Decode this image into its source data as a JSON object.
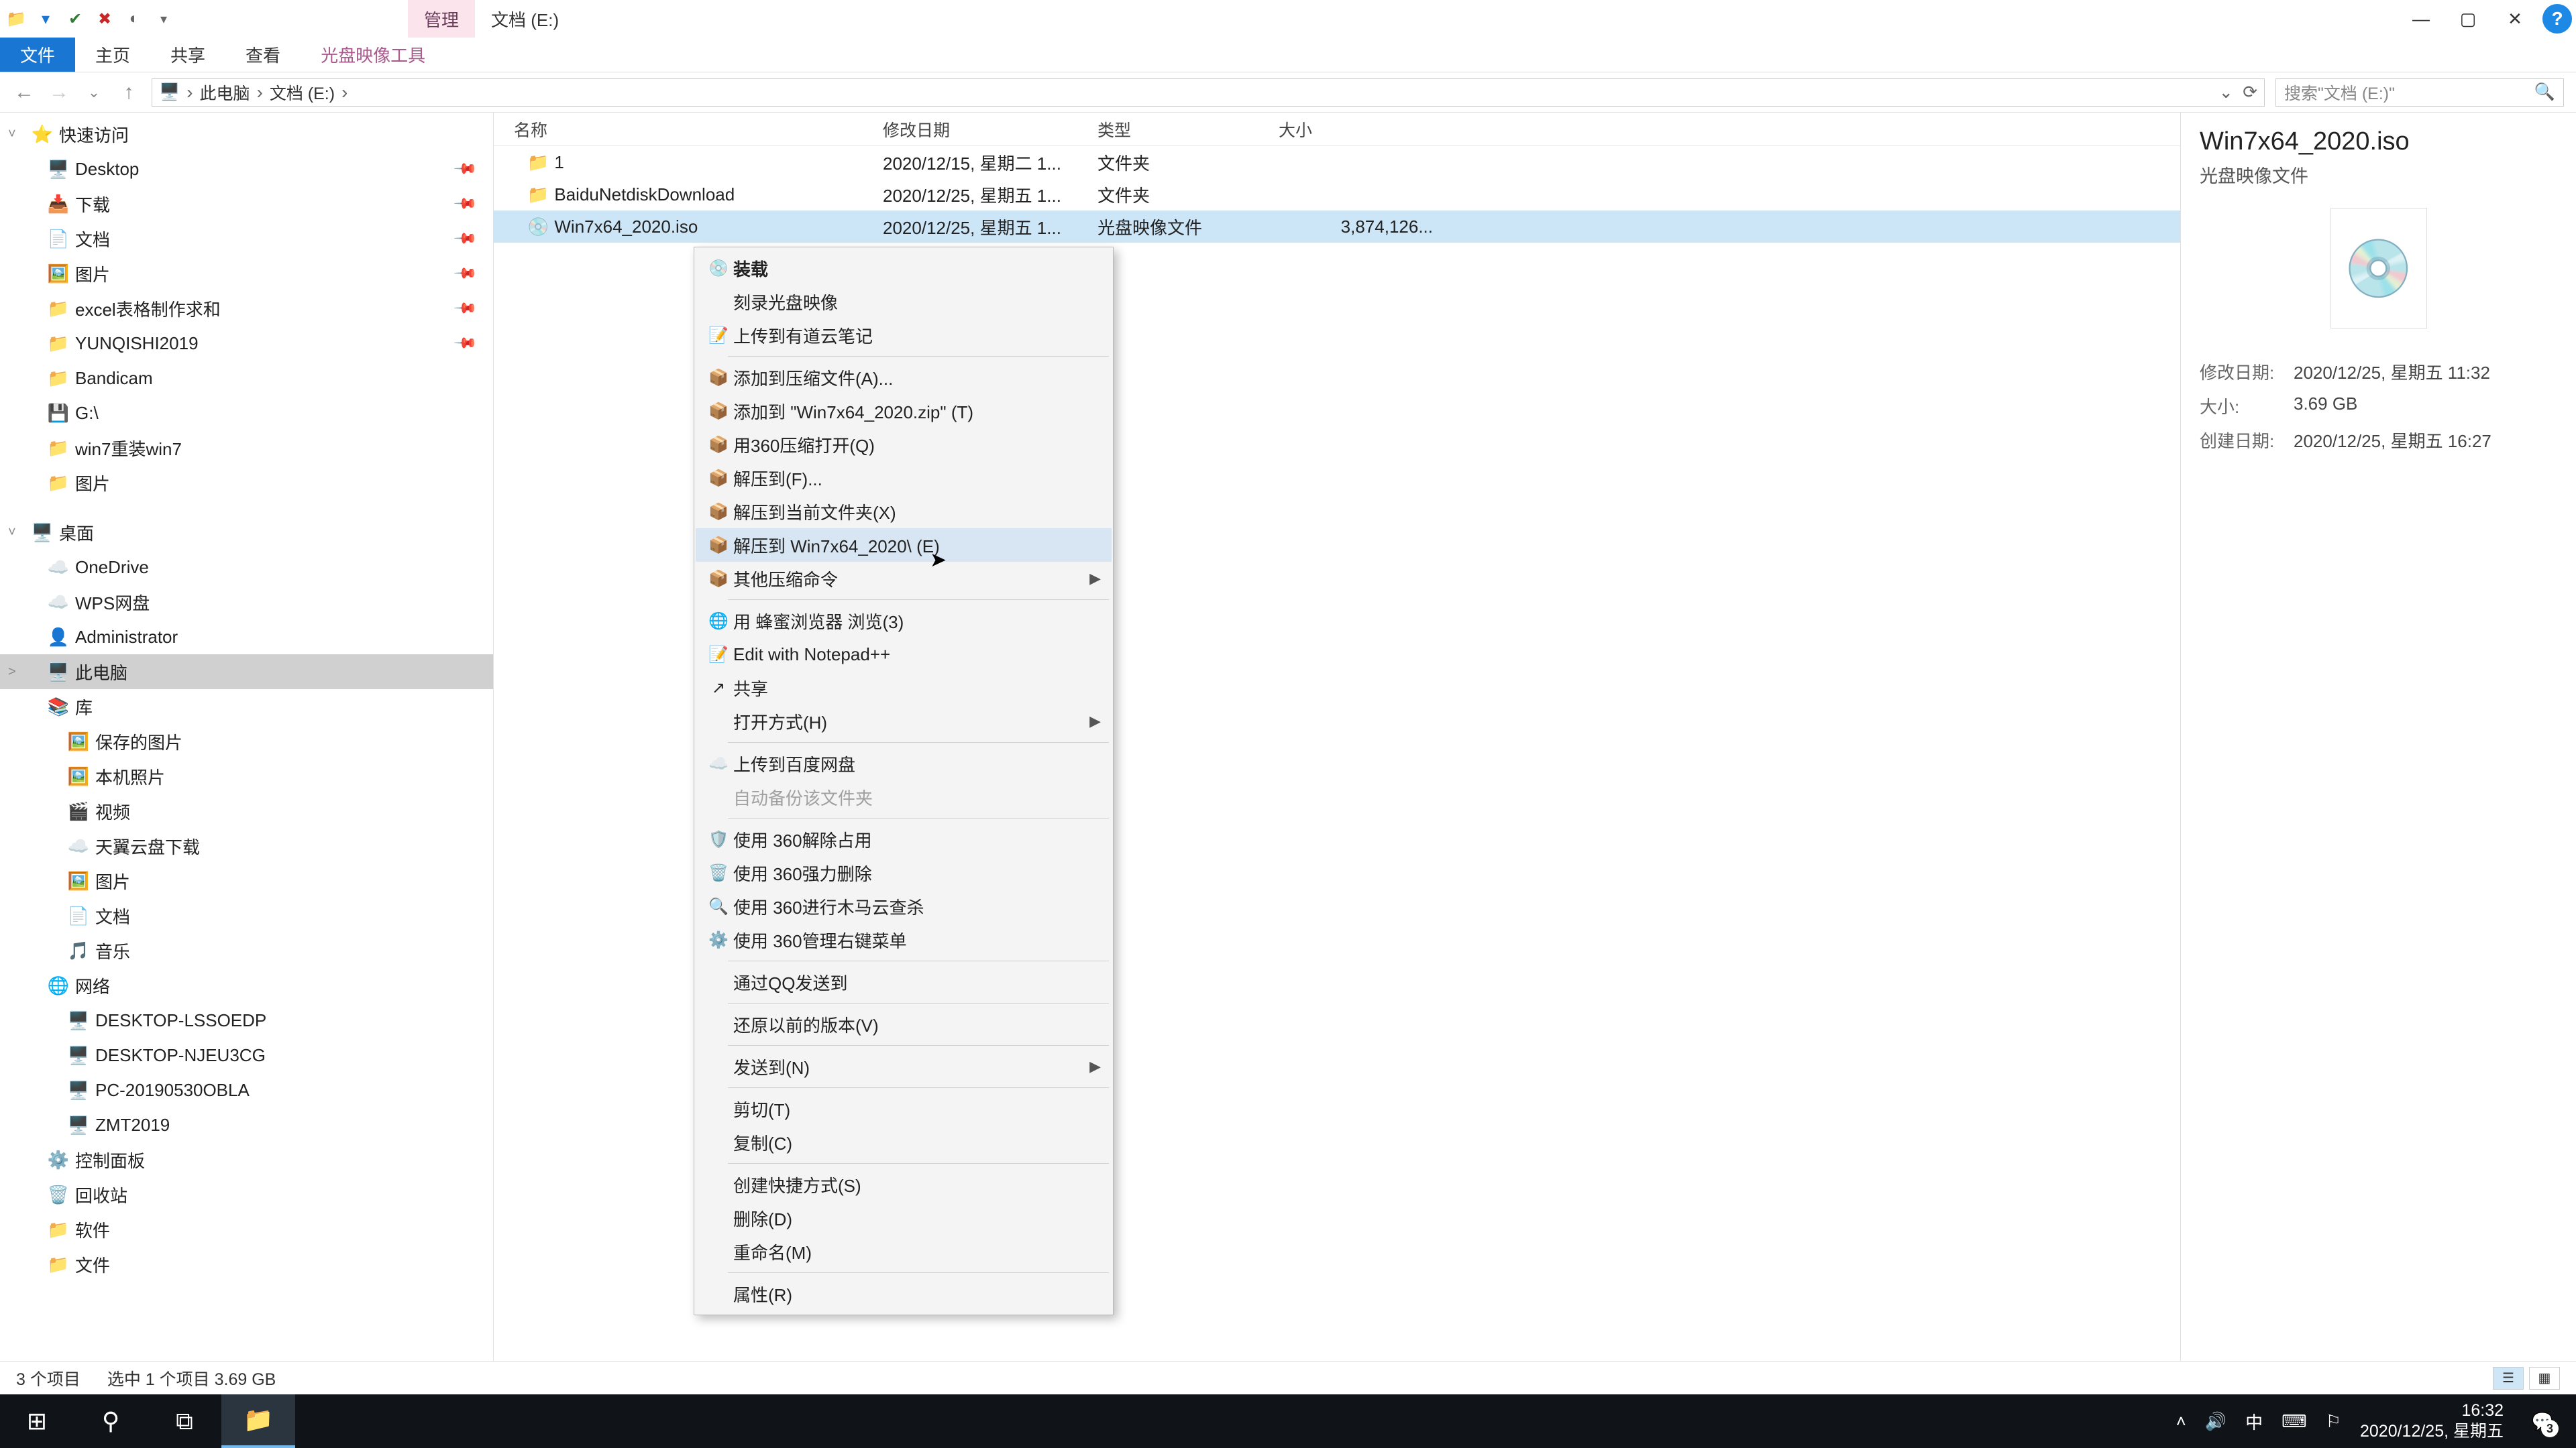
{
  "window": {
    "context_tab": "管理",
    "title": "文档 (E:)",
    "controls": {
      "min": "—",
      "max": "▢",
      "close": "✕",
      "help": "?"
    }
  },
  "ribbon": {
    "tabs": [
      "文件",
      "主页",
      "共享",
      "查看"
    ],
    "context_tab": "光盘映像工具"
  },
  "address": {
    "crumbs": [
      "此电脑",
      "文档 (E:)"
    ],
    "search_placeholder": "搜索\"文档 (E:)\""
  },
  "sidebar": {
    "quick_access": {
      "label": "快速访问",
      "items": [
        {
          "icon": "🖥️",
          "label": "Desktop",
          "pinned": true
        },
        {
          "icon": "📥",
          "label": "下载",
          "pinned": true
        },
        {
          "icon": "📄",
          "label": "文档",
          "pinned": true
        },
        {
          "icon": "🖼️",
          "label": "图片",
          "pinned": true
        },
        {
          "icon": "📁",
          "label": "excel表格制作求和",
          "pinned": true
        },
        {
          "icon": "📁",
          "label": "YUNQISHI2019",
          "pinned": true
        },
        {
          "icon": "📁",
          "label": "Bandicam"
        },
        {
          "icon": "💾",
          "label": "G:\\"
        },
        {
          "icon": "📁",
          "label": "win7重装win7"
        },
        {
          "icon": "📁",
          "label": "图片"
        }
      ]
    },
    "desktop": {
      "label": "桌面",
      "items": [
        {
          "icon": "☁️",
          "label": "OneDrive"
        },
        {
          "icon": "☁️",
          "label": "WPS网盘"
        },
        {
          "icon": "👤",
          "label": "Administrator"
        },
        {
          "icon": "🖥️",
          "label": "此电脑",
          "selected": true
        },
        {
          "icon": "📚",
          "label": "库"
        }
      ]
    },
    "libraries": [
      {
        "icon": "🖼️",
        "label": "保存的图片"
      },
      {
        "icon": "🖼️",
        "label": "本机照片"
      },
      {
        "icon": "🎬",
        "label": "视频"
      },
      {
        "icon": "☁️",
        "label": "天翼云盘下载"
      },
      {
        "icon": "🖼️",
        "label": "图片"
      },
      {
        "icon": "📄",
        "label": "文档"
      },
      {
        "icon": "🎵",
        "label": "音乐"
      }
    ],
    "network": {
      "label": "网络",
      "items": [
        {
          "icon": "🖥️",
          "label": "DESKTOP-LSSOEDP"
        },
        {
          "icon": "🖥️",
          "label": "DESKTOP-NJEU3CG"
        },
        {
          "icon": "🖥️",
          "label": "PC-20190530OBLA"
        },
        {
          "icon": "🖥️",
          "label": "ZMT2019"
        }
      ]
    },
    "tail": [
      {
        "icon": "⚙️",
        "label": "控制面板"
      },
      {
        "icon": "🗑️",
        "label": "回收站"
      },
      {
        "icon": "📁",
        "label": "软件"
      },
      {
        "icon": "📁",
        "label": "文件"
      }
    ]
  },
  "columns": {
    "name": "名称",
    "date": "修改日期",
    "type": "类型",
    "size": "大小"
  },
  "files": [
    {
      "icon": "📁",
      "name": "1",
      "date": "2020/12/15, 星期二 1...",
      "type": "文件夹",
      "size": ""
    },
    {
      "icon": "📁",
      "name": "BaiduNetdiskDownload",
      "date": "2020/12/25, 星期五 1...",
      "type": "文件夹",
      "size": ""
    },
    {
      "icon": "💿",
      "name": "Win7x64_2020.iso",
      "date": "2020/12/25, 星期五 1...",
      "type": "光盘映像文件",
      "size": "3,874,126...",
      "selected": true
    }
  ],
  "context_menu": {
    "groups": [
      [
        {
          "icon": "💿",
          "label": "装载",
          "bold": true
        },
        {
          "icon": "",
          "label": "刻录光盘映像"
        },
        {
          "icon": "📝",
          "label": "上传到有道云笔记"
        }
      ],
      [
        {
          "icon": "📦",
          "label": "添加到压缩文件(A)..."
        },
        {
          "icon": "📦",
          "label": "添加到 \"Win7x64_2020.zip\" (T)"
        },
        {
          "icon": "📦",
          "label": "用360压缩打开(Q)"
        },
        {
          "icon": "📦",
          "label": "解压到(F)..."
        },
        {
          "icon": "📦",
          "label": "解压到当前文件夹(X)"
        },
        {
          "icon": "📦",
          "label": "解压到 Win7x64_2020\\ (E)",
          "hover": true
        },
        {
          "icon": "📦",
          "label": "其他压缩命令",
          "submenu": true
        }
      ],
      [
        {
          "icon": "🌐",
          "label": "用 蜂蜜浏览器 浏览(3)"
        },
        {
          "icon": "📝",
          "label": "Edit with Notepad++"
        },
        {
          "icon": "↗",
          "label": "共享"
        },
        {
          "icon": "",
          "label": "打开方式(H)",
          "submenu": true
        }
      ],
      [
        {
          "icon": "☁️",
          "label": "上传到百度网盘"
        },
        {
          "icon": "",
          "label": "自动备份该文件夹",
          "disabled": true
        }
      ],
      [
        {
          "icon": "🛡️",
          "label": "使用 360解除占用"
        },
        {
          "icon": "🗑️",
          "label": "使用 360强力删除"
        },
        {
          "icon": "🔍",
          "label": "使用 360进行木马云查杀"
        },
        {
          "icon": "⚙️",
          "label": "使用 360管理右键菜单"
        }
      ],
      [
        {
          "icon": "",
          "label": "通过QQ发送到"
        }
      ],
      [
        {
          "icon": "",
          "label": "还原以前的版本(V)"
        }
      ],
      [
        {
          "icon": "",
          "label": "发送到(N)",
          "submenu": true
        }
      ],
      [
        {
          "icon": "",
          "label": "剪切(T)"
        },
        {
          "icon": "",
          "label": "复制(C)"
        }
      ],
      [
        {
          "icon": "",
          "label": "创建快捷方式(S)"
        },
        {
          "icon": "",
          "label": "删除(D)"
        },
        {
          "icon": "",
          "label": "重命名(M)"
        }
      ],
      [
        {
          "icon": "",
          "label": "属性(R)"
        }
      ]
    ]
  },
  "details": {
    "title": "Win7x64_2020.iso",
    "subtitle": "光盘映像文件",
    "rows": [
      {
        "k": "修改日期:",
        "v": "2020/12/25, 星期五 11:32"
      },
      {
        "k": "大小:",
        "v": "3.69 GB"
      },
      {
        "k": "创建日期:",
        "v": "2020/12/25, 星期五 16:27"
      }
    ]
  },
  "status": {
    "count": "3 个项目",
    "selected": "选中 1 个项目  3.69 GB"
  },
  "taskbar": {
    "tray": {
      "ime": "中",
      "time": "16:32",
      "date": "2020/12/25, 星期五",
      "notif_count": "3"
    }
  }
}
